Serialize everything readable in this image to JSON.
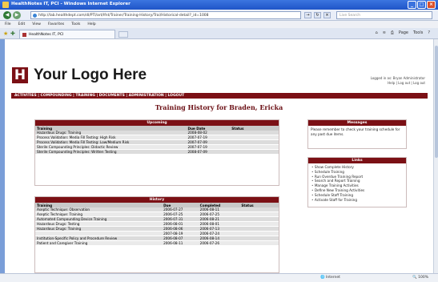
{
  "window": {
    "title": "HealthNotes IT, PCI - Windows Internet Explorer",
    "address": "http://lab.healthdept.com/dl/PTI/art/lfnt/Trainer/Training-History/Trai/Historical-detail?_id=1008",
    "search_placeholder": "Live Search",
    "tab_label": "HealthNotes IT, PCI",
    "menu": [
      "File",
      "Edit",
      "View",
      "Favorites",
      "Tools",
      "Help"
    ],
    "tools": [
      "Page",
      "Tools"
    ],
    "status_zone": "Internet",
    "status_zoom": "100%"
  },
  "header": {
    "logo_letter": "H",
    "logo_text": "Your Logo Here",
    "login_line1": "Logged in as: Bryan Administrator",
    "login_line2": "Help | Log out | Log out"
  },
  "mainnav": "ACTIVITIES | COMPOUNDING | TRAINING | DOCUMENTS | ADMINISTRATION | LOGOUT",
  "page_title": "Training History for Braden, Ericka",
  "upcoming": {
    "heading": "Upcoming",
    "columns": [
      "Training",
      "Due Date",
      "Status"
    ],
    "rows": [
      [
        "Hazardous Drugs: Training",
        "2008-08-02",
        ""
      ],
      [
        "Process Validation: Media Fill Testing: High Risk",
        "2007-07-19",
        ""
      ],
      [
        "Process Validation: Media Fill Testing: Low/Medium Risk",
        "2007-07-09",
        ""
      ],
      [
        "Sterile Compounding Principles: Didactic Review",
        "2007-07-19",
        ""
      ],
      [
        "Sterile Compounding Principles: Written Testing",
        "2008-07-09",
        ""
      ]
    ]
  },
  "history": {
    "heading": "History",
    "columns": [
      "Training",
      "Due",
      "Completed",
      "Status"
    ],
    "rows": [
      [
        "Aseptic Technique: Observation",
        "2006-07-27",
        "2006-08-11",
        ""
      ],
      [
        "Aseptic Technique: Training",
        "2006-07-25",
        "2006-07-25",
        ""
      ],
      [
        "Automated Compounding Device Training",
        "2006-07-31",
        "2006-08-21",
        ""
      ],
      [
        "Hazardous Drugs: Testing",
        "2006-08-01",
        "2006-08-01",
        ""
      ],
      [
        "Hazardous Drugs: Training",
        "2006-08-06",
        "2006-07-13",
        ""
      ],
      [
        "",
        "2007-08-19",
        "2006-07-24",
        ""
      ],
      [
        "Institution-Specific Policy and Procedure Review",
        "2006-08-07",
        "2006-08-14",
        ""
      ],
      [
        "Patient and Caregiver Training",
        "2006-08-11",
        "2006-07-26",
        ""
      ]
    ]
  },
  "messages": {
    "heading": "Messages",
    "body": "Please remember to check your training schedule for any past due items."
  },
  "links": {
    "heading": "Links",
    "items": [
      "Show Complete History",
      "Schedule Training",
      "Run Overdue Training Report",
      "Search and Report Training",
      "Manage Training Activities",
      "Define New Training Activities",
      "Schedule Staff Training",
      "Activate Staff for Training"
    ]
  }
}
